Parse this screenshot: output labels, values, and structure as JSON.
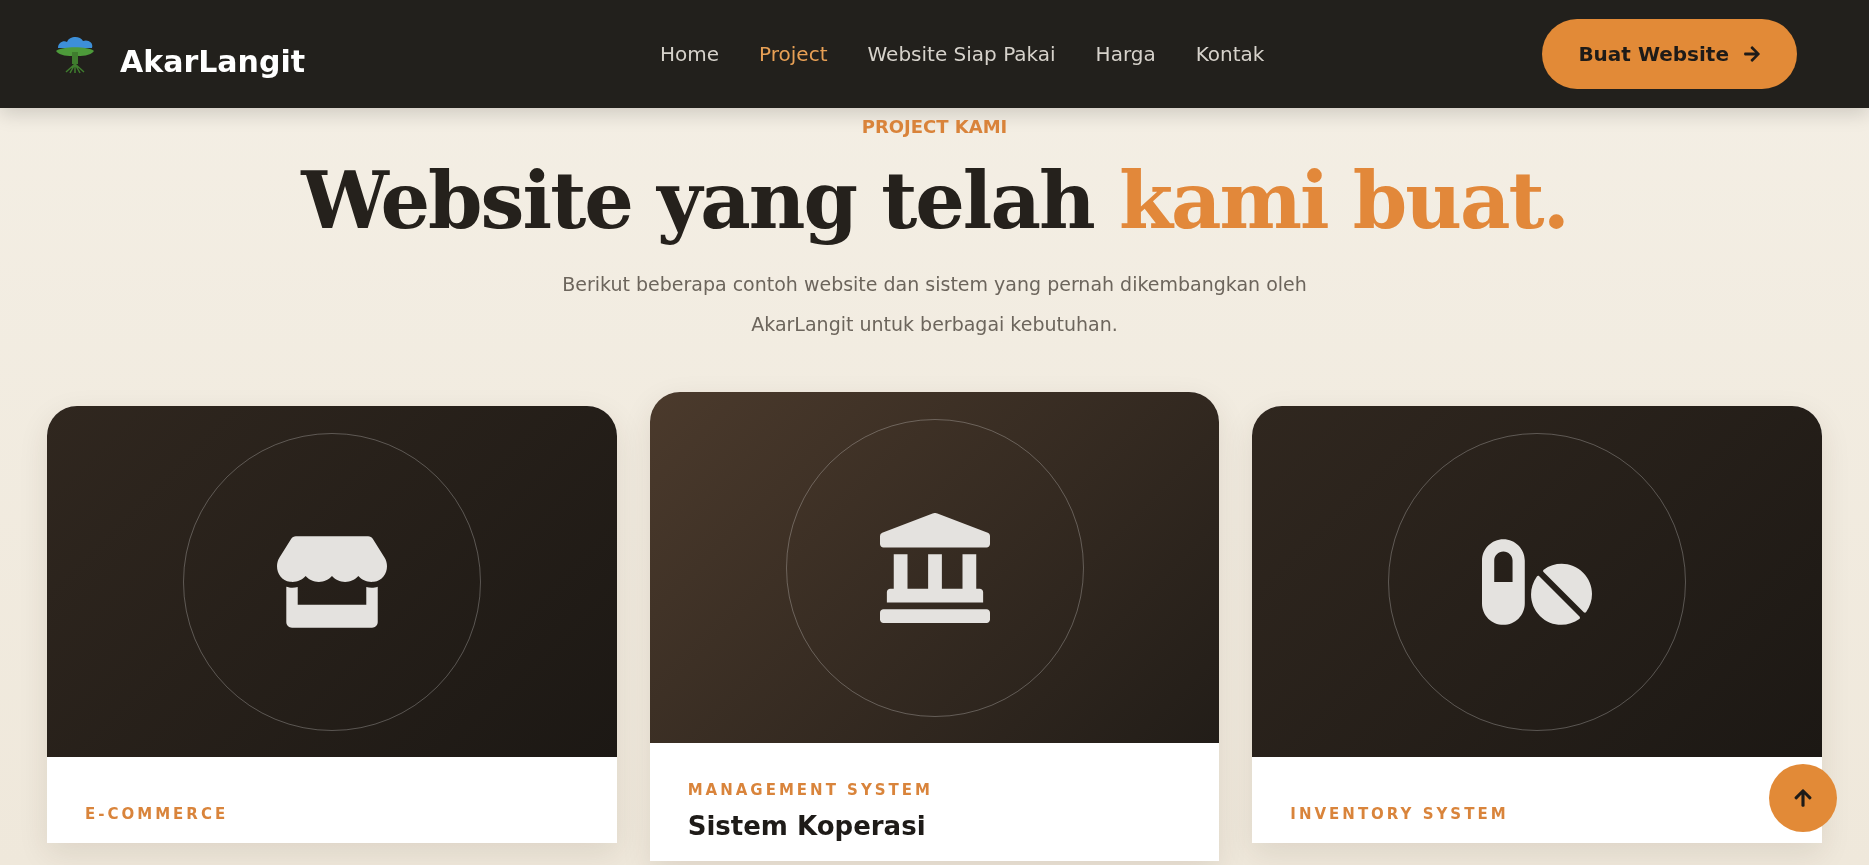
{
  "navbar": {
    "brand": "AkarLangit",
    "links": [
      {
        "label": "Home",
        "selected": false
      },
      {
        "label": "Project",
        "selected": true
      },
      {
        "label": "Website Siap Pakai",
        "selected": false
      },
      {
        "label": "Harga",
        "selected": false
      },
      {
        "label": "Kontak",
        "selected": false
      }
    ],
    "cta": "Buat Website"
  },
  "hero": {
    "eyebrow": "PROJECT KAMI",
    "title_plain": "Website yang telah",
    "title_accent": "kami buat.",
    "subtitle_lines": [
      "Berikut beberapa contoh website dan sistem yang pernah dikembangkan oleh",
      "AkarLangit untuk berbagai kebutuhan."
    ]
  },
  "projects": [
    {
      "kind": "store",
      "category": "E-COMMERCE",
      "featured": false
    },
    {
      "kind": "bank",
      "category": "MANAGEMENT SYSTEM",
      "title": "Sistem Koperasi",
      "featured": true
    },
    {
      "kind": "pills",
      "category": "INVENTORY SYSTEM",
      "featured": false
    }
  ]
}
